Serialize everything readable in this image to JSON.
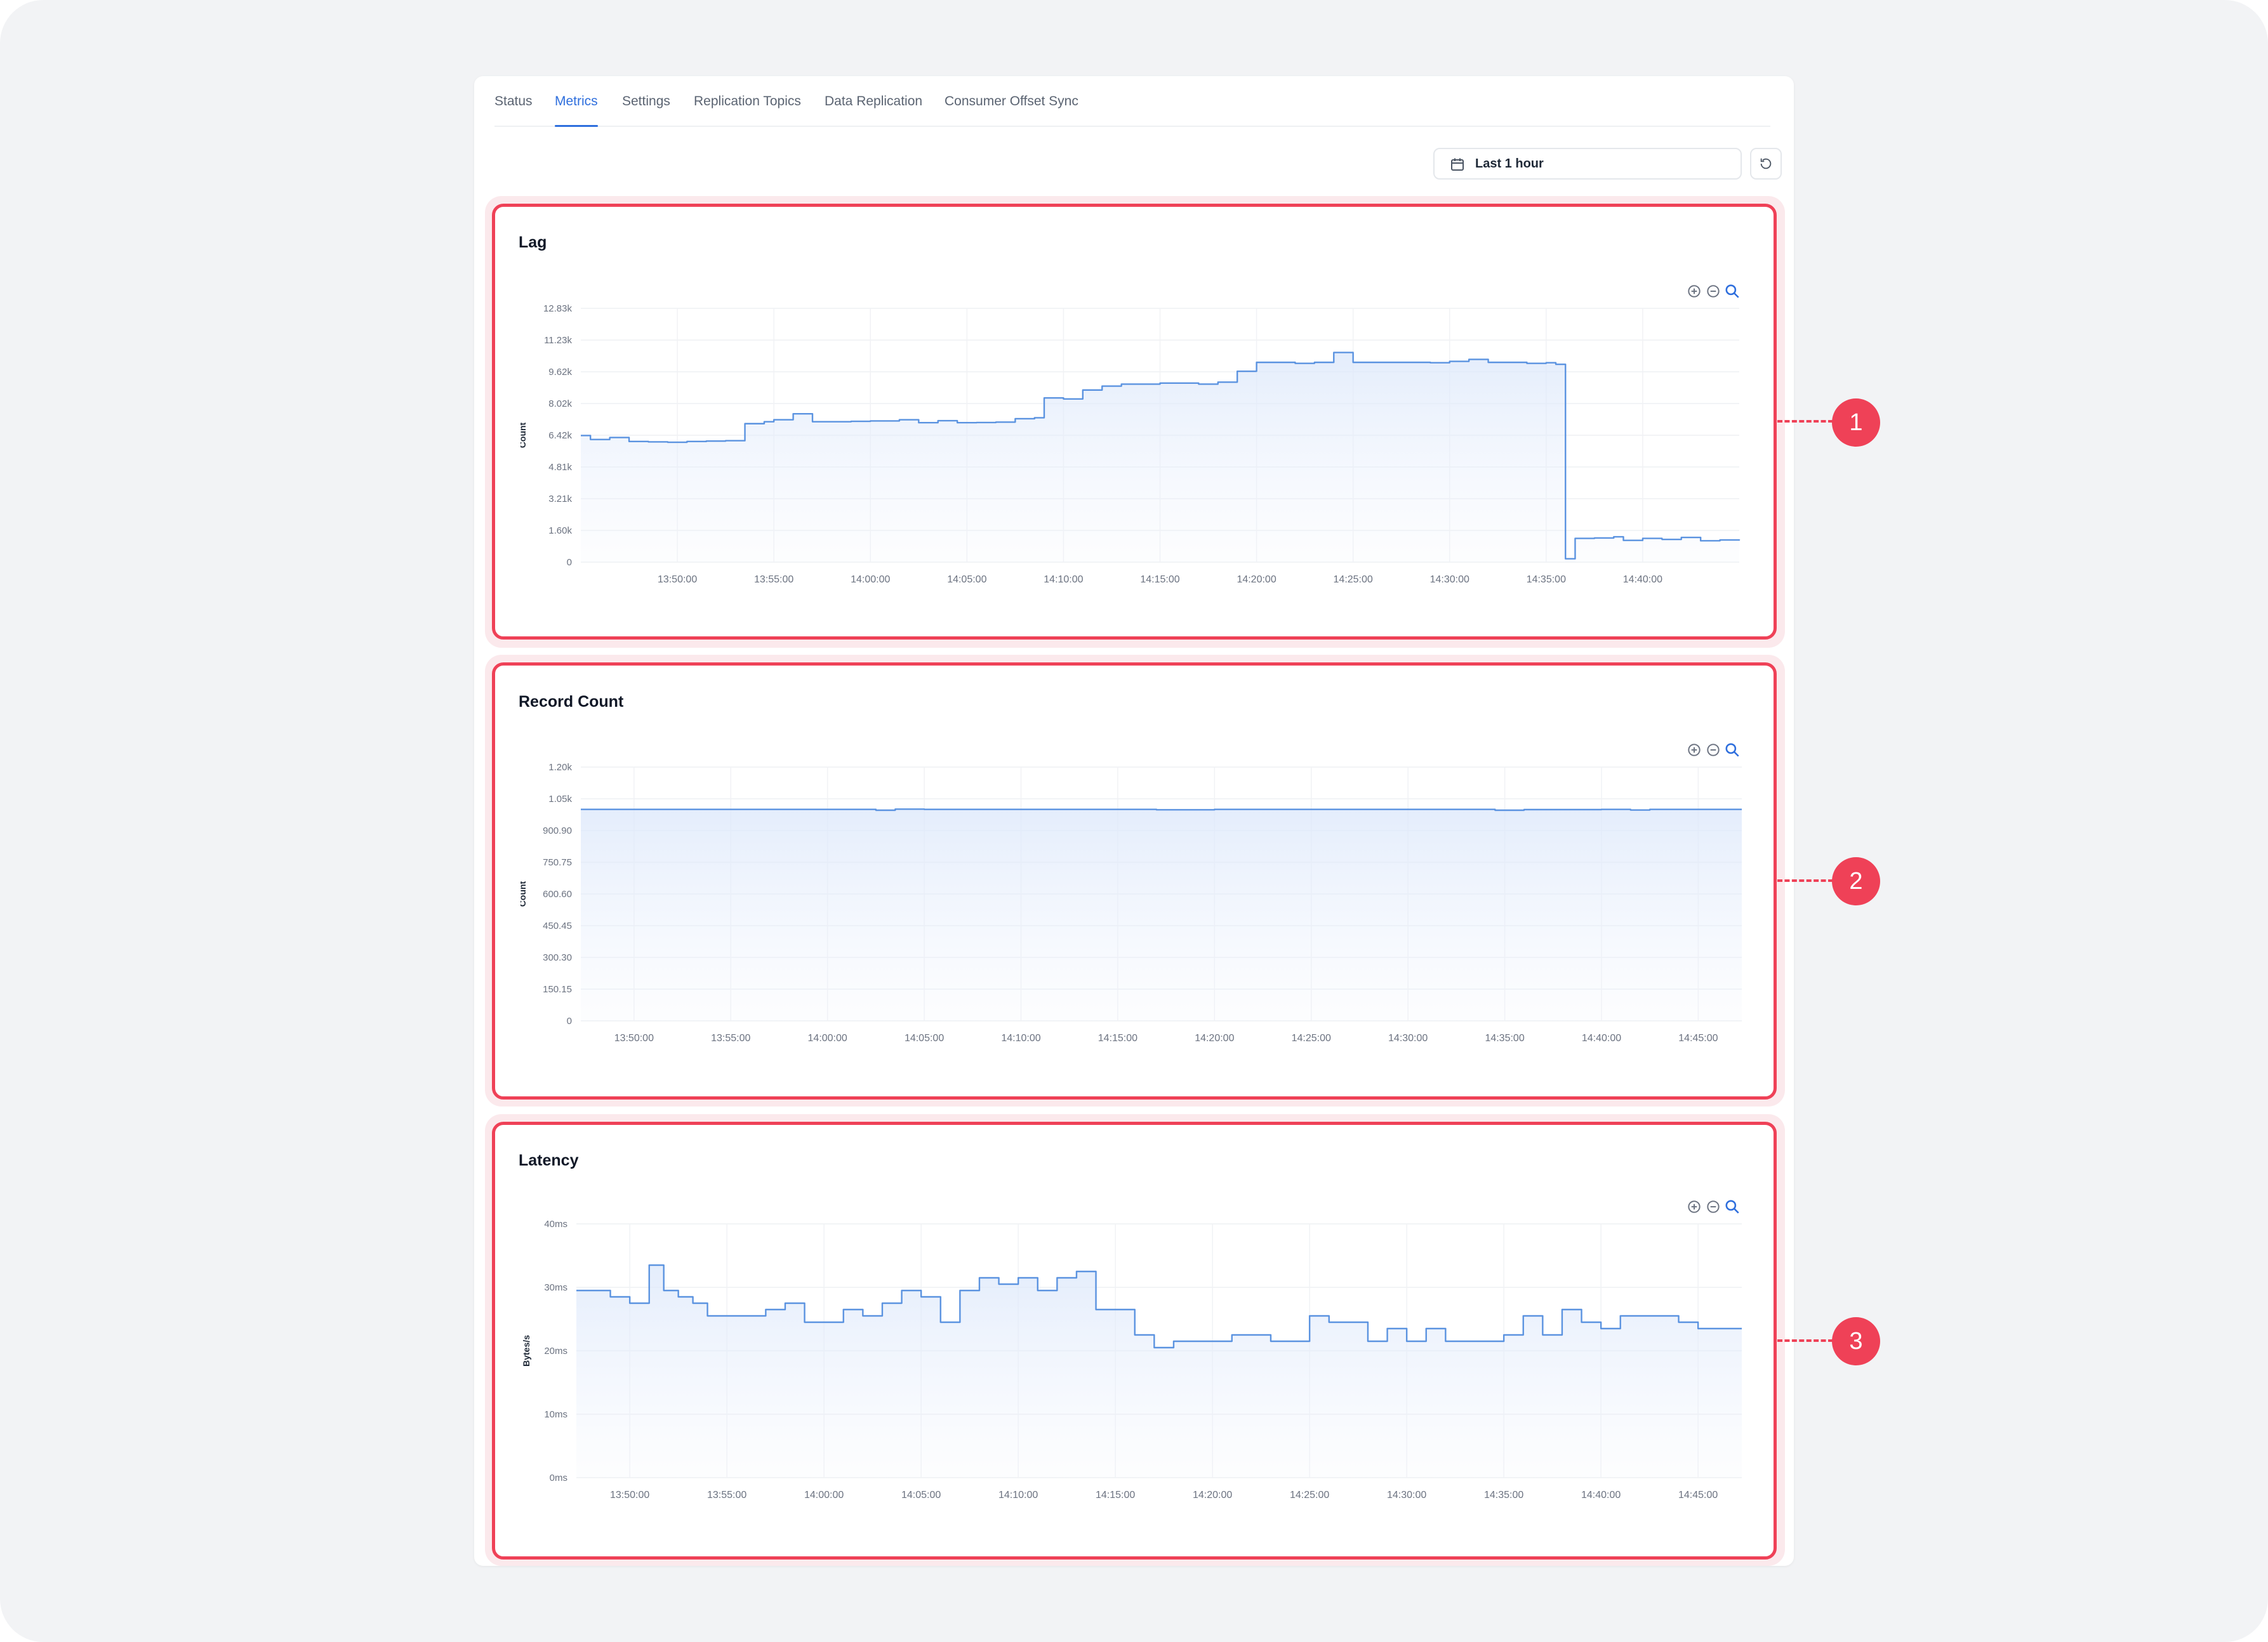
{
  "tabs": [
    {
      "label": "Status",
      "active": false
    },
    {
      "label": "Metrics",
      "active": true
    },
    {
      "label": "Settings",
      "active": false
    },
    {
      "label": "Replication Topics",
      "active": false
    },
    {
      "label": "Data Replication",
      "active": false
    },
    {
      "label": "Consumer Offset Sync",
      "active": false
    }
  ],
  "time_range": {
    "label": "Last 1 hour",
    "icon": "calendar-icon"
  },
  "refresh_icon": "refresh-icon",
  "chart_toolbar_icons": [
    "zoom-in-icon",
    "zoom-out-icon",
    "zoom-reset-icon"
  ],
  "colors": {
    "accent": "#2f6fdd",
    "series_line": "#5b93e0",
    "callout": "#ef4157"
  },
  "callouts": [
    "1",
    "2",
    "3"
  ],
  "chart_data": [
    {
      "type": "area",
      "title": "Lag",
      "ylabel": "Count",
      "xlabel": "",
      "grid": true,
      "ylim": [
        0,
        12830
      ],
      "yticks": [
        "0",
        "1.60k",
        "3.21k",
        "4.81k",
        "6.42k",
        "8.02k",
        "9.62k",
        "11.23k",
        "12.83k"
      ],
      "xticks": [
        "13:50:00",
        "13:55:00",
        "14:00:00",
        "14:05:00",
        "14:10:00",
        "14:15:00",
        "14:20:00",
        "14:25:00",
        "14:30:00",
        "14:35:00",
        "14:40:00"
      ],
      "xrange": [
        "13:45:00",
        "14:45:00"
      ],
      "series": [
        {
          "x": [
            "13:45:00",
            "13:45:30",
            "13:46:30",
            "13:47:30",
            "13:48:30",
            "13:49:30",
            "13:50:30",
            "13:51:30",
            "13:52:30",
            "13:53:30",
            "13:54:30",
            "13:55:00",
            "13:56:00",
            "13:57:00",
            "13:58:00",
            "13:59:00",
            "14:00:00",
            "14:01:30",
            "14:02:30",
            "14:03:30",
            "14:04:30",
            "14:05:30",
            "14:06:30",
            "14:07:30",
            "14:08:30",
            "14:09:00",
            "14:10:00",
            "14:11:00",
            "14:12:00",
            "14:13:00",
            "14:15:00",
            "14:17:00",
            "14:18:00",
            "14:19:00",
            "14:20:00",
            "14:22:00",
            "14:23:00",
            "14:24:00",
            "14:25:00",
            "14:27:00",
            "14:29:00",
            "14:30:00",
            "14:31:00",
            "14:32:00",
            "14:34:00",
            "14:35:00",
            "14:35:30",
            "14:36:00",
            "14:36:30",
            "14:37:30",
            "14:38:30",
            "14:39:00",
            "14:40:00",
            "14:41:00",
            "14:42:00",
            "14:43:00",
            "14:44:00",
            "14:45:00"
          ],
          "y": [
            6400,
            6200,
            6300,
            6100,
            6080,
            6060,
            6100,
            6120,
            6140,
            7000,
            7100,
            7200,
            7500,
            7100,
            7100,
            7120,
            7140,
            7200,
            7050,
            7150,
            7050,
            7060,
            7080,
            7250,
            7300,
            8300,
            8250,
            8700,
            8900,
            9000,
            9050,
            9000,
            9100,
            9650,
            10100,
            10050,
            10100,
            10600,
            10100,
            10100,
            10080,
            10150,
            10250,
            10100,
            10050,
            10080,
            10000,
            170,
            1200,
            1220,
            1280,
            1100,
            1200,
            1150,
            1250,
            1080,
            1120,
            1150
          ]
        }
      ]
    },
    {
      "type": "area",
      "title": "Record Count",
      "ylabel": "Count",
      "xlabel": "",
      "grid": true,
      "ylim": [
        0,
        1200
      ],
      "yticks": [
        "0",
        "150.15",
        "300.30",
        "450.45",
        "600.60",
        "750.75",
        "900.90",
        "1.05k",
        "1.20k"
      ],
      "xticks": [
        "13:50:00",
        "13:55:00",
        "14:00:00",
        "14:05:00",
        "14:10:00",
        "14:15:00",
        "14:20:00",
        "14:25:00",
        "14:30:00",
        "14:35:00",
        "14:40:00",
        "14:45:00"
      ],
      "xrange": [
        "13:47:15",
        "14:47:15"
      ],
      "series": [
        {
          "x": [
            "13:47:15",
            "13:50:00",
            "13:55:00",
            "14:00:00",
            "14:02:30",
            "14:03:30",
            "14:05:00",
            "14:10:00",
            "14:15:00",
            "14:17:00",
            "14:20:00",
            "14:25:00",
            "14:30:00",
            "14:34:30",
            "14:36:00",
            "14:40:00",
            "14:41:30",
            "14:42:30",
            "14:45:00",
            "14:47:15"
          ],
          "y": [
            1000,
            1000,
            1000,
            1000,
            996,
            1001,
            1000,
            1000,
            1000,
            998,
            1000,
            1000,
            1000,
            996,
            999,
            1000,
            997,
            1000,
            1000,
            1000
          ]
        }
      ]
    },
    {
      "type": "area",
      "title": "Latency",
      "ylabel": "Bytes/s",
      "xlabel": "",
      "grid": true,
      "ylim": [
        0,
        40
      ],
      "yticks": [
        "0ms",
        "10ms",
        "20ms",
        "30ms",
        "40ms"
      ],
      "xticks": [
        "13:50:00",
        "13:55:00",
        "14:00:00",
        "14:05:00",
        "14:10:00",
        "14:15:00",
        "14:20:00",
        "14:25:00",
        "14:30:00",
        "14:35:00",
        "14:40:00",
        "14:45:00"
      ],
      "xrange": [
        "13:47:15",
        "14:47:15"
      ],
      "series": [
        {
          "x": [
            "13:47:15",
            "13:49:00",
            "13:50:00",
            "13:51:00",
            "13:51:45",
            "13:52:30",
            "13:53:15",
            "13:54:00",
            "13:55:00",
            "13:57:00",
            "13:58:00",
            "13:59:00",
            "14:01:00",
            "14:02:00",
            "14:03:00",
            "14:04:00",
            "14:05:00",
            "14:06:00",
            "14:07:00",
            "14:08:00",
            "14:09:00",
            "14:10:00",
            "14:11:00",
            "14:12:00",
            "14:13:00",
            "14:14:00",
            "14:16:00",
            "14:17:00",
            "14:18:00",
            "14:20:00",
            "14:21:00",
            "14:23:00",
            "14:25:00",
            "14:26:00",
            "14:28:00",
            "14:29:00",
            "14:30:00",
            "14:31:00",
            "14:32:00",
            "14:33:00",
            "14:35:00",
            "14:36:00",
            "14:37:00",
            "14:38:00",
            "14:39:00",
            "14:40:00",
            "14:41:00",
            "14:42:00",
            "14:44:00",
            "14:45:00",
            "14:47:15"
          ],
          "y": [
            29.5,
            28.5,
            27.5,
            33.5,
            29.5,
            28.5,
            27.5,
            25.5,
            25.5,
            26.5,
            27.5,
            24.5,
            26.5,
            25.5,
            27.5,
            29.5,
            28.5,
            24.5,
            29.5,
            31.5,
            30.5,
            31.5,
            29.5,
            31.5,
            32.5,
            26.5,
            22.5,
            20.5,
            21.5,
            21.5,
            22.5,
            21.5,
            25.5,
            24.5,
            21.5,
            23.5,
            21.5,
            23.5,
            21.5,
            21.5,
            22.5,
            25.5,
            22.5,
            26.5,
            24.5,
            23.5,
            25.5,
            25.5,
            24.5,
            23.5,
            23.5
          ]
        }
      ]
    }
  ]
}
